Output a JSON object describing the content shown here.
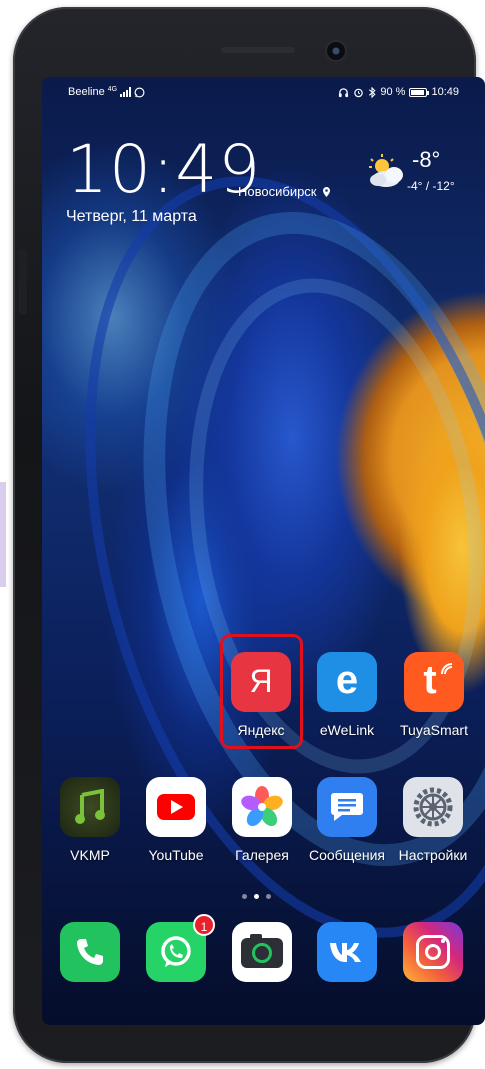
{
  "status_bar": {
    "carrier": "Beeline",
    "network": "4G",
    "battery_percent": "90 %",
    "time": "10:49"
  },
  "lock_widget": {
    "clock": "10:49",
    "date": "Четверг, 11 марта",
    "city": "Новосибирск",
    "temperature": "-8°",
    "range": "-4° / -12°"
  },
  "apps_row1": [
    {
      "label": "Яндекс",
      "icon": "yandex-icon",
      "glyph": "Я",
      "color": "#e73542"
    },
    {
      "label": "eWeLink",
      "icon": "ewelink-icon",
      "glyph": "e",
      "color": "#1f8fe6"
    },
    {
      "label": "TuyaSmart",
      "icon": "tuyasmart-icon",
      "glyph": "t",
      "color": "#ff5a1f"
    }
  ],
  "apps_row2": [
    {
      "label": "VKMP",
      "icon": "vkmp-icon"
    },
    {
      "label": "YouTube",
      "icon": "youtube-icon"
    },
    {
      "label": "Галерея",
      "icon": "gallery-icon"
    },
    {
      "label": "Сообщения",
      "icon": "messages-icon"
    },
    {
      "label": "Настройки",
      "icon": "settings-icon"
    }
  ],
  "dock": [
    {
      "icon": "phone-icon"
    },
    {
      "icon": "whatsapp-icon",
      "badge": "1"
    },
    {
      "icon": "camera-icon"
    },
    {
      "icon": "vk-icon"
    },
    {
      "icon": "instagram-icon"
    }
  ],
  "highlight_color": "#e0101c"
}
